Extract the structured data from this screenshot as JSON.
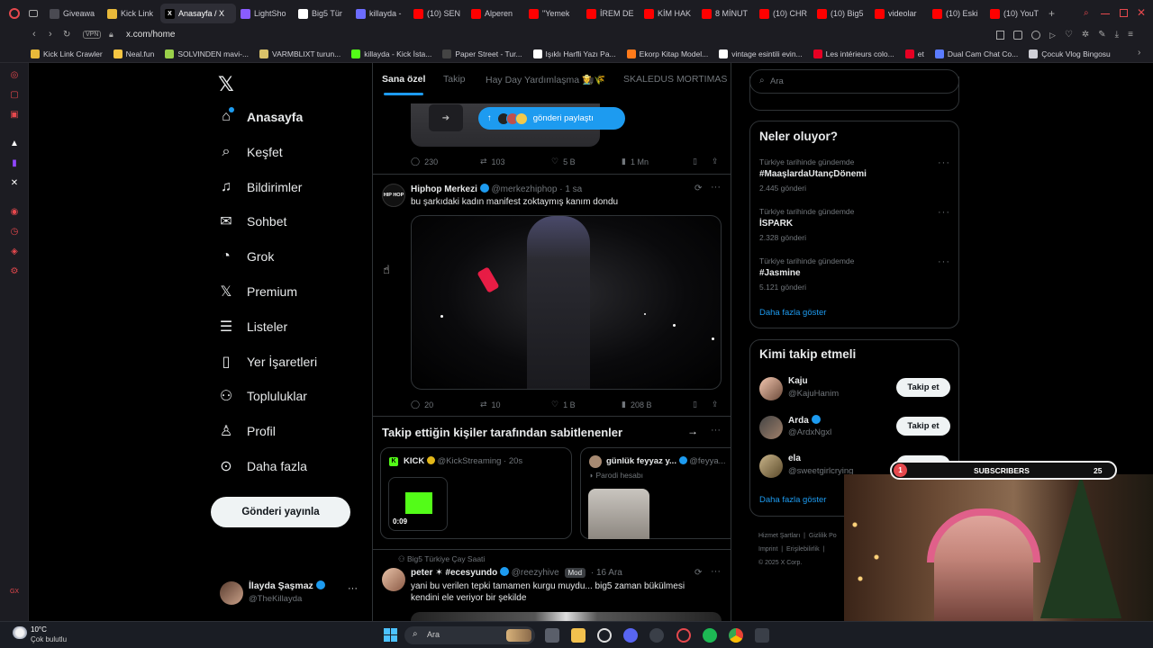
{
  "browser": {
    "tabs": [
      {
        "label": "Giveawa",
        "color": "#4a4a52",
        "glyph": ""
      },
      {
        "label": "Kick Link",
        "color": "#e8b93a",
        "glyph": ""
      },
      {
        "label": "Anasayfa / X",
        "color": "#000000",
        "glyph": "X",
        "active": true
      },
      {
        "label": "LightSho",
        "color": "#8a5cff",
        "glyph": ""
      },
      {
        "label": "Big5 Tür",
        "color": "#ffffff",
        "glyph": ""
      },
      {
        "label": "killayda -",
        "color": "#6c6cff",
        "glyph": ""
      },
      {
        "label": "(10) SEN",
        "color": "#ff0000",
        "glyph": ""
      },
      {
        "label": "Alperen",
        "color": "#ff0000",
        "glyph": ""
      },
      {
        "label": "\"Yemek",
        "color": "#ff0000",
        "glyph": ""
      },
      {
        "label": "İREM DE",
        "color": "#ff0000",
        "glyph": ""
      },
      {
        "label": "KİM HAK",
        "color": "#ff0000",
        "glyph": ""
      },
      {
        "label": "8 MİNUT",
        "color": "#ff0000",
        "glyph": ""
      },
      {
        "label": "(10) CHR",
        "color": "#ff0000",
        "glyph": ""
      },
      {
        "label": "(10) Big5",
        "color": "#ff0000",
        "glyph": ""
      },
      {
        "label": "videolar",
        "color": "#ff0000",
        "glyph": ""
      },
      {
        "label": "(10) Eski",
        "color": "#ff0000",
        "glyph": ""
      },
      {
        "label": "(10) YouT",
        "color": "#ff0000",
        "glyph": ""
      }
    ],
    "url": "x.com/home",
    "vpn_label": "VPN",
    "bookmarks": [
      {
        "label": "Kick Link Crawler",
        "color": "#e8b93a"
      },
      {
        "label": "Neal.fun",
        "color": "#f5c542"
      },
      {
        "label": "SOLVINDEN mavi-...",
        "color": "#9ad04a"
      },
      {
        "label": "VARMBLIXT turun...",
        "color": "#d9c26a"
      },
      {
        "label": "killayda - Kick İsta...",
        "color": "#53fc18"
      },
      {
        "label": "Paper Street - Tur...",
        "color": "#444444"
      },
      {
        "label": "Işıklı Harfli Yazı Pa...",
        "color": "#ffffff"
      },
      {
        "label": "Ekorp Kitap Model...",
        "color": "#ff7a1a"
      },
      {
        "label": "vintage esintili evin...",
        "color": "#ffffff"
      },
      {
        "label": "Les intérieurs colo...",
        "color": "#e60023"
      },
      {
        "label": "et",
        "color": "#e60023"
      },
      {
        "label": "Dual Cam Chat Co...",
        "color": "#5b7cff"
      },
      {
        "label": "Çocuk Vlog Bingosu",
        "color": "#cfcfd6"
      }
    ]
  },
  "nav": {
    "items": [
      {
        "label": "Anasayfa",
        "icon": "home-icon",
        "active": true
      },
      {
        "label": "Keşfet",
        "icon": "search-icon"
      },
      {
        "label": "Bildirimler",
        "icon": "bell-icon"
      },
      {
        "label": "Sohbet",
        "icon": "mail-icon"
      },
      {
        "label": "Grok",
        "icon": "grok-icon"
      },
      {
        "label": "Premium",
        "icon": "x-logo-icon"
      },
      {
        "label": "Listeler",
        "icon": "list-icon"
      },
      {
        "label": "Yer İşaretleri",
        "icon": "bookmark-icon"
      },
      {
        "label": "Topluluklar",
        "icon": "communities-icon"
      },
      {
        "label": "Profil",
        "icon": "person-icon"
      },
      {
        "label": "Daha fazla",
        "icon": "more-circle-icon"
      }
    ],
    "post_button": "Gönderi yayınla",
    "account": {
      "name": "İlayda Şaşmaz",
      "handle": "@TheKillayda"
    }
  },
  "feed": {
    "tabs": [
      "Sana özel",
      "Takip",
      "Hay Day Yardımlaşma 👩‍🌾🌾",
      "SKALEDUS MORTIMAS"
    ],
    "shared_badge": "gönderi paylaştı",
    "post1_stats": {
      "replies": "230",
      "reposts": "103",
      "likes": "5 B",
      "views": "1 Mn"
    },
    "post2": {
      "name": "Hiphop Merkezi",
      "handle": "@merkezhiphop",
      "time": "· 1 sa",
      "text": "bu şarkıdaki kadın manifest zoktaymış kanım dondu",
      "avatar_text": "HIP HOP",
      "stats": {
        "replies": "20",
        "reposts": "10",
        "likes": "1 B",
        "views": "208 B"
      }
    },
    "pinned": {
      "title": "Takip ettiğin kişiler tarafından sabitlenenler",
      "card1": {
        "name": "KICK",
        "handle": "@KickStreaming · 20s",
        "duration": "0:09"
      },
      "card2": {
        "name": "günlük feyyaz y...",
        "handle": "@feyya...",
        "sub": "Parodi hesabı"
      }
    },
    "post3": {
      "context": "Big5 Türkiye Çay Saati",
      "name": "peter ✶ #ecesyundo",
      "handle": "@reezyhive",
      "badge": "Mod",
      "time": "· 16 Ara",
      "text": "yani bu verilen tepki tamamen kurgu muydu... big5 zaman bükülmesi kendini ele veriyor bir şekilde"
    }
  },
  "right": {
    "search_placeholder": "Ara",
    "trends_title": "Neler oluyor?",
    "trends": [
      {
        "context": "Türkiye tarihinde gündemde",
        "name": "#MaaşlardaUtançDönemi",
        "count": "2.445 gönderi"
      },
      {
        "context": "Türkiye tarihinde gündemde",
        "name": "İSPARK",
        "count": "2.328 gönderi"
      },
      {
        "context": "Türkiye tarihinde gündemde",
        "name": "#Jasmine",
        "count": "5.121 gönderi"
      }
    ],
    "show_more": "Daha fazla göster",
    "who_title": "Kimi takip etmeli",
    "who": [
      {
        "name": "Kaju",
        "handle": "@KajuHanim",
        "button": "Takip et"
      },
      {
        "name": "Arda",
        "handle": "@ArdxNgxl",
        "button": "Takip et"
      },
      {
        "name": "ela",
        "handle": "@sweetgirlcrying",
        "button": "Takip et"
      }
    ],
    "who_more": "Daha fazla göster",
    "footer": [
      "Hizmet Şartları",
      "Gizlilik Po",
      "Imprint",
      "Erişilebilirlik",
      "© 2025 X Corp."
    ]
  },
  "overlay": {
    "level": "1",
    "label": "SUBSCRIBERS",
    "count": "25"
  },
  "taskbar": {
    "weather_temp": "10°C",
    "weather_desc": "Çok bulutlu",
    "search": "Ara"
  }
}
